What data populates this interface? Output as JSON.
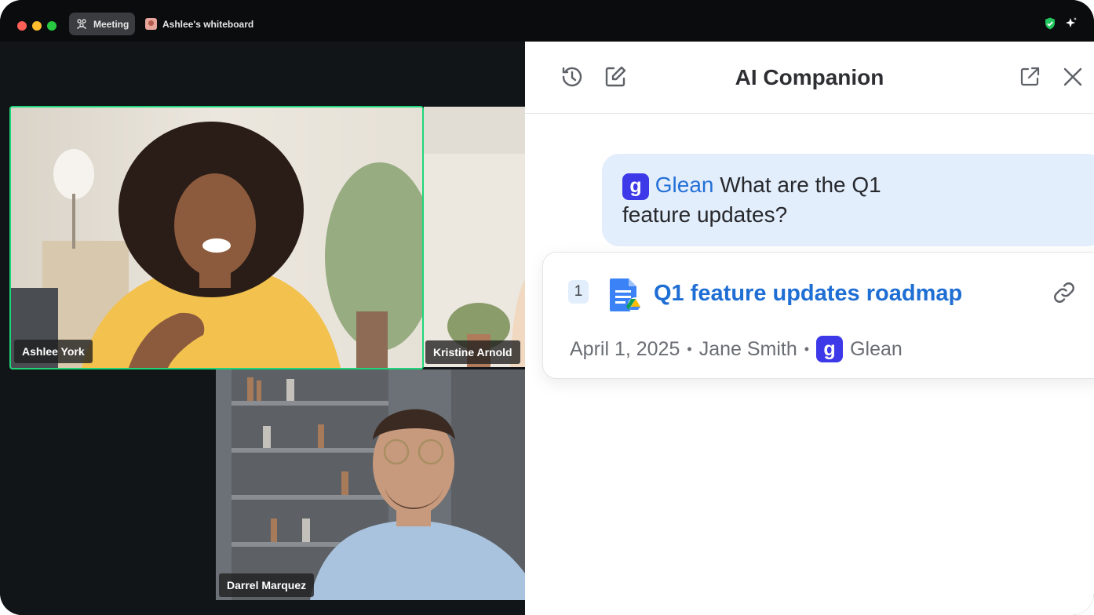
{
  "titlebar": {
    "tabs": [
      {
        "label": "Meeting",
        "icon": "people-icon"
      },
      {
        "label": "Ashlee's whiteboard",
        "icon": "whiteboard-thumbnail"
      }
    ],
    "right_icons": [
      "shield-check-icon",
      "sparkle-icon"
    ]
  },
  "participants": [
    {
      "name": "Ashlee York",
      "active_speaker": true
    },
    {
      "name": "Kristine Arnold",
      "active_speaker": false
    },
    {
      "name": "Darrel Marquez",
      "active_speaker": false
    }
  ],
  "panel": {
    "title": "AI Companion",
    "header_icons": [
      "history-icon",
      "compose-icon",
      "pop-out-icon",
      "close-icon"
    ],
    "query": {
      "source": "Glean",
      "line1": "What are the Q1",
      "line2": "feature updates?"
    },
    "result": {
      "index": "1",
      "title": "Q1 feature updates roadmap",
      "date": "April 1, 2025",
      "author": "Jane Smith",
      "source": "Glean"
    }
  },
  "colors": {
    "active_speaker_border": "#1ed67a",
    "glean_brand": "#3d39e8",
    "link_blue": "#1f6ed4",
    "bubble_bg": "#e3eefc"
  }
}
